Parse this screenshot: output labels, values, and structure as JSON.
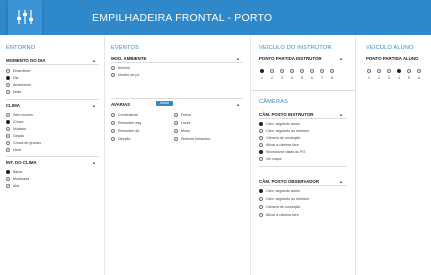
{
  "header": {
    "title": "EMPILHADEIRA FRONTAL - PORTO",
    "logo_icon": "equalizer-sliders-icon"
  },
  "entorno": {
    "title": "ENTORNO",
    "momento": {
      "title": "MOMENTO DO DIA",
      "options": [
        "Entardecer",
        "Dia",
        "Amanhecer",
        "Noite"
      ],
      "selected": 1
    },
    "clima": {
      "title": "CLIMA",
      "options": [
        "Sem nuvens",
        "Chuva",
        "Nublado",
        "Geada",
        "Chuva de granizo",
        "Neve"
      ],
      "selected": 1
    },
    "int_clima": {
      "title": "INT. DO CLIMA",
      "options": [
        "Baixa",
        "Moderada",
        "Alta"
      ],
      "selected": 0
    }
  },
  "eventos": {
    "title": "EVENTOS",
    "mod_ambiente": {
      "title": "MOD. AMBIENTE",
      "options": [
        "Amiche",
        "Nuvem de pó"
      ]
    },
    "avarias": {
      "title": "AVARIAS",
      "button": "limitar",
      "left": [
        "Combustível",
        "Retrovisor esq.",
        "Retrovisor dir.",
        "Direção"
      ],
      "right": [
        "Freios",
        "Luzes",
        "Motor",
        "Sistema hidráulico"
      ]
    }
  },
  "veiculo_instrutor": {
    "title": "VEÍCULO DO INSTRUTOR",
    "partida": {
      "title": "PONTO PARTIDA INSTRUTOR",
      "numbers": [
        "1",
        "2",
        "3",
        "4",
        "5",
        "6",
        "7",
        "8"
      ],
      "selected": 0
    }
  },
  "cameras": {
    "title": "CÂMERAS",
    "instrutor": {
      "title": "CÂM. POSTO INSTRUTOR",
      "options": [
        "Câm. seguindo aluno",
        "Câm. seguindo do instrutor",
        "Câmera de condução",
        "Ativar a câmera livre",
        "Sincronizar vistas do PO",
        "Ver mapa"
      ],
      "selected": [
        0,
        4
      ]
    },
    "observador": {
      "title": "CÂM. POSTO OBSERVADOR",
      "options": [
        "Câm. seguindo aluno",
        "Câm. seguindo do instrutor",
        "Câmera de condução",
        "Ativar a câmera livre"
      ],
      "selected": [
        0
      ]
    }
  },
  "veiculo_aluno": {
    "title": "VEÍCULO ALUNO",
    "partida": {
      "title": "PONTO PARTIDA ALUNO",
      "numbers": [
        "1",
        "2",
        "3",
        "4",
        "5",
        "6"
      ],
      "selected": 3
    }
  },
  "colors": {
    "accent": "#2f88c9",
    "background": "#ffffff"
  }
}
